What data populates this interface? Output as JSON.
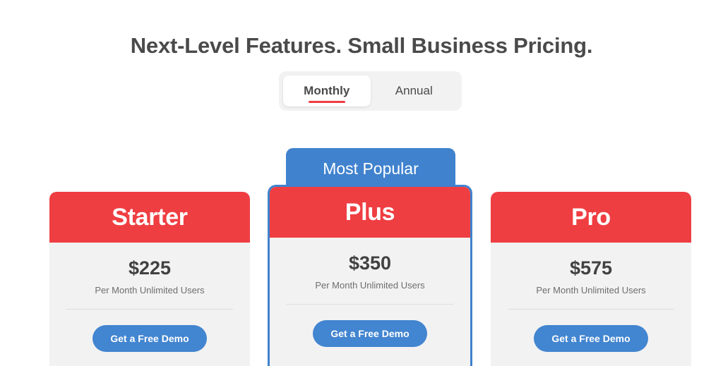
{
  "heading": "Next-Level Features. Small Business Pricing.",
  "billing_toggle": {
    "monthly_label": "Monthly",
    "annual_label": "Annual",
    "selected": "Monthly"
  },
  "colors": {
    "header_red": "#ef3e42",
    "accent_blue": "#4082ce",
    "button_blue": "#4285d0",
    "card_background": "#f2f2f2",
    "title_text": "#4a4a4a"
  },
  "featured_badge": "Most Popular",
  "plans": [
    {
      "name": "Starter",
      "price": "$225",
      "period": "Per Month Unlimited Users",
      "cta": "Get a Free Demo",
      "featured": false
    },
    {
      "name": "Plus",
      "price": "$350",
      "period": "Per Month Unlimited Users",
      "cta": "Get a Free Demo",
      "featured": true
    },
    {
      "name": "Pro",
      "price": "$575",
      "period": "Per Month Unlimited Users",
      "cta": "Get a Free Demo",
      "featured": false
    }
  ]
}
